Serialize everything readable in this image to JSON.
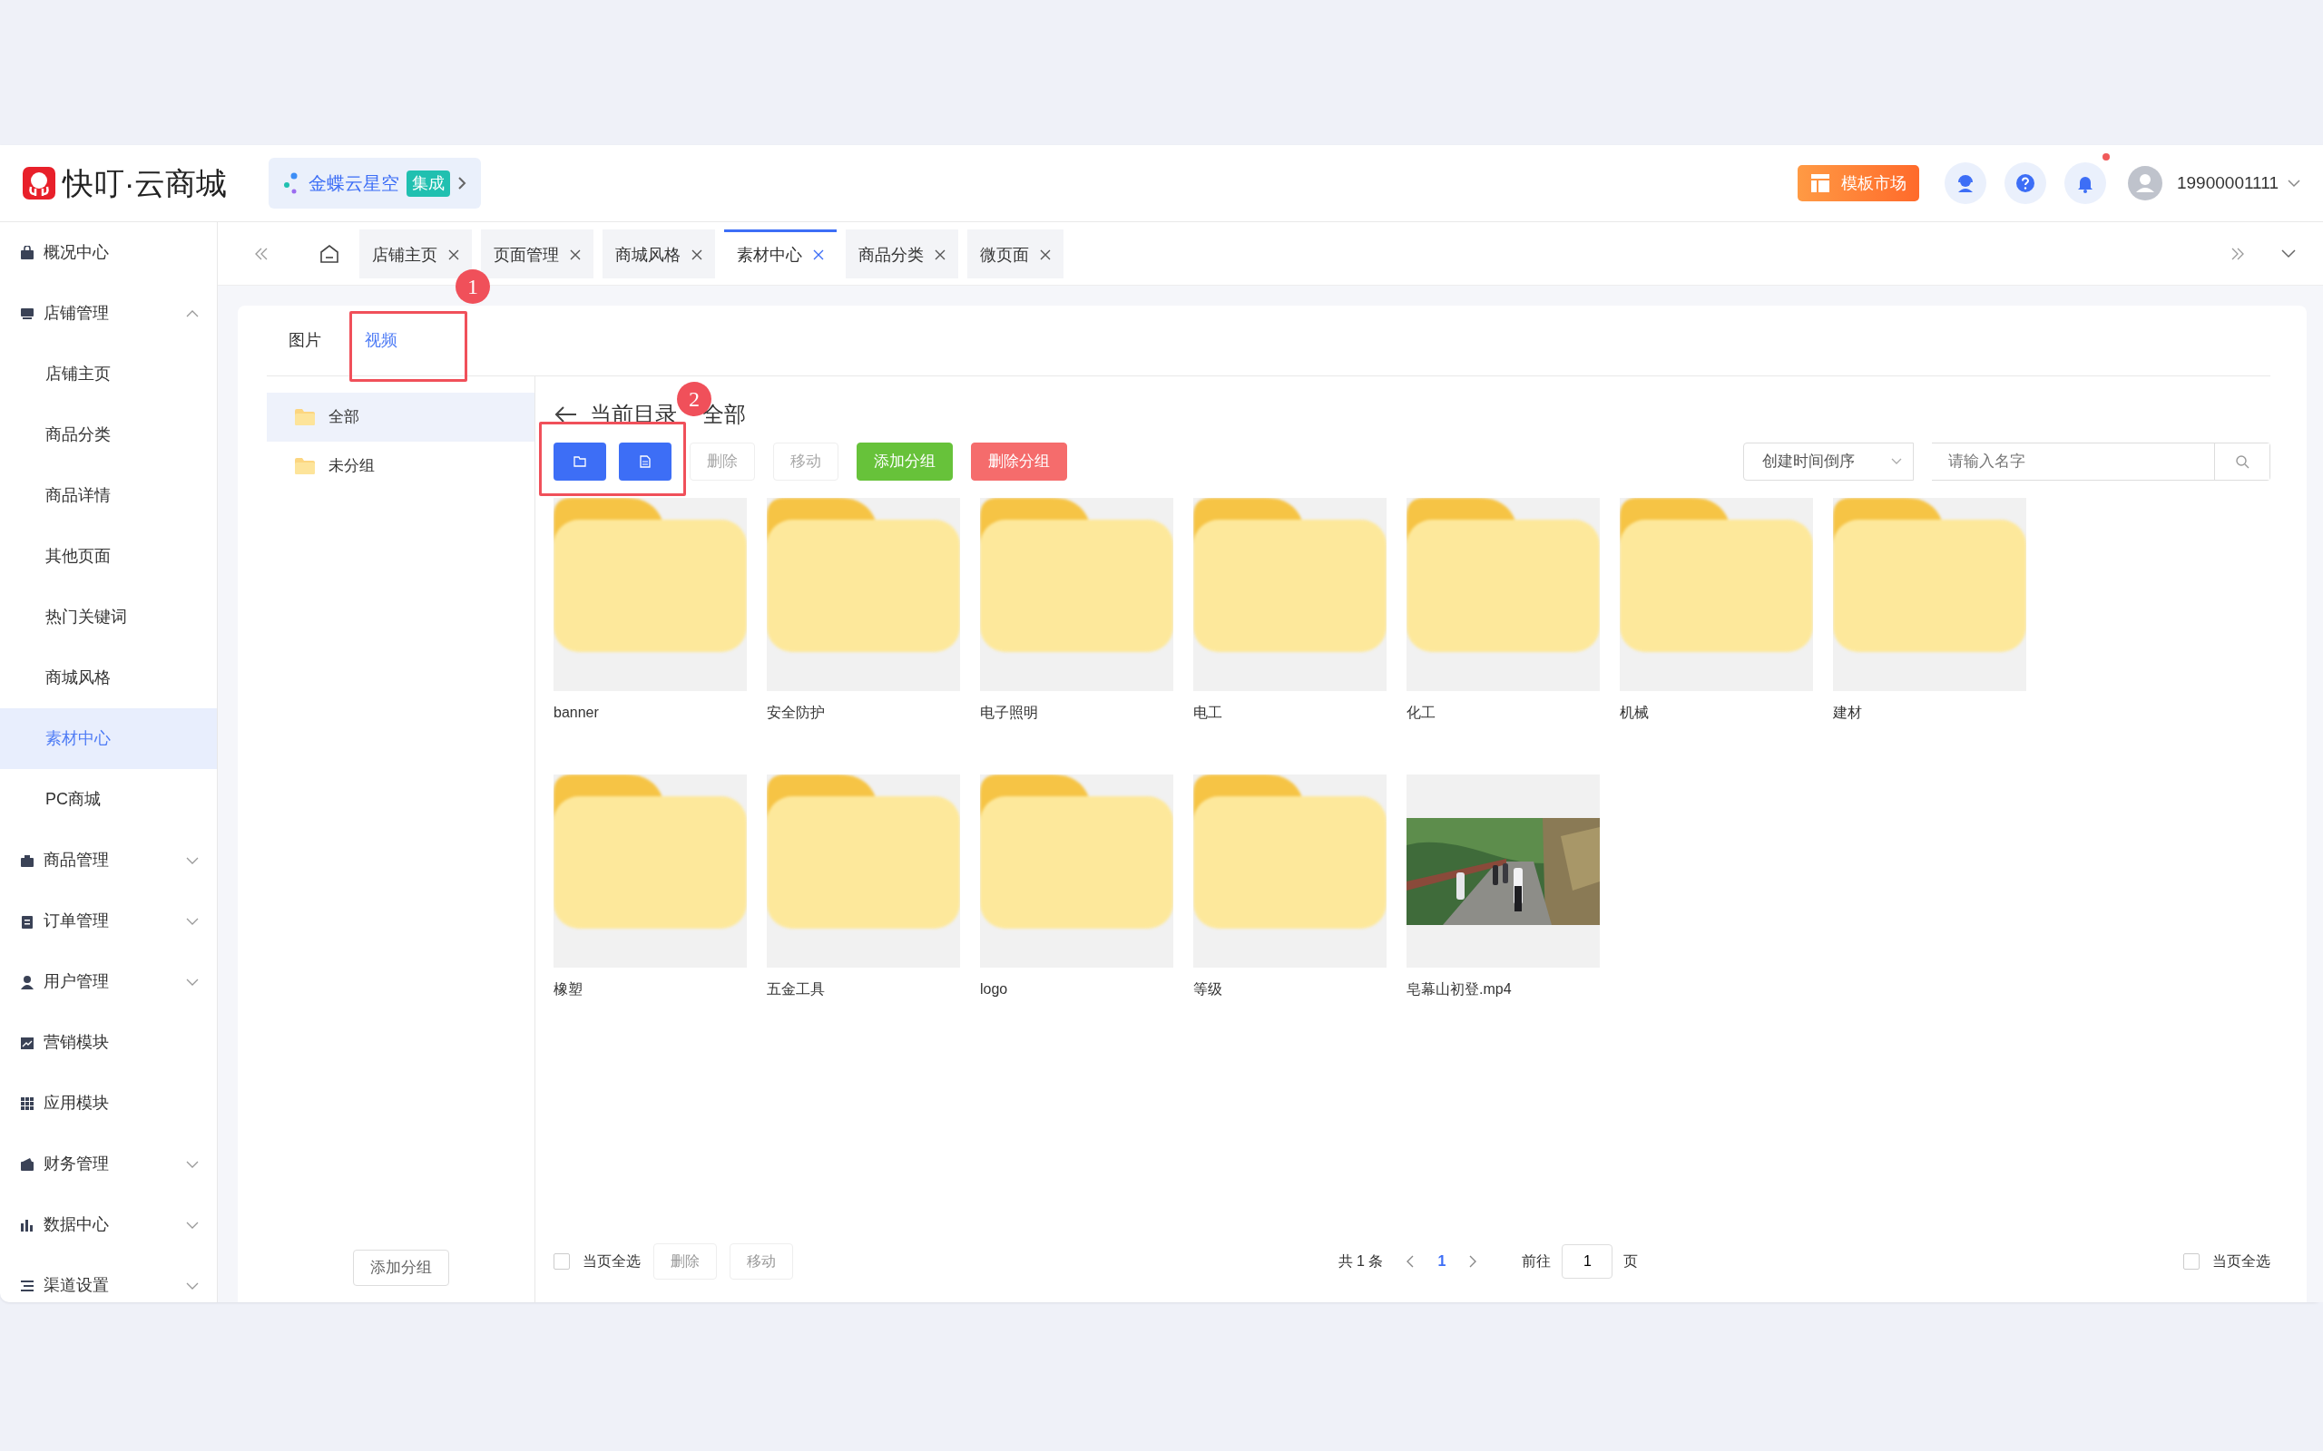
{
  "header": {
    "logo_text": "快叮·云商城",
    "integration": {
      "label": "金蝶云星空",
      "badge": "集成"
    },
    "market_button": "模板市场",
    "notification_dot": true,
    "user": "19900001111"
  },
  "sidebar": {
    "items": [
      {
        "kind": "link",
        "label": "概况中心",
        "selected": false
      },
      {
        "kind": "group",
        "label": "店铺管理",
        "expanded": true,
        "children": [
          {
            "label": "店铺主页",
            "selected": false
          },
          {
            "label": "商品分类",
            "selected": false
          },
          {
            "label": "商品详情",
            "selected": false
          },
          {
            "label": "其他页面",
            "selected": false
          },
          {
            "label": "热门关键词",
            "selected": false
          },
          {
            "label": "商城风格",
            "selected": false
          },
          {
            "label": "素材中心",
            "selected": true
          },
          {
            "label": "PC商城",
            "selected": false
          }
        ]
      },
      {
        "kind": "group",
        "label": "商品管理",
        "expanded": false
      },
      {
        "kind": "group",
        "label": "订单管理",
        "expanded": false
      },
      {
        "kind": "group",
        "label": "用户管理",
        "expanded": false
      },
      {
        "kind": "link",
        "label": "营销模块",
        "selected": false
      },
      {
        "kind": "link",
        "label": "应用模块",
        "selected": false
      },
      {
        "kind": "group",
        "label": "财务管理",
        "expanded": false
      },
      {
        "kind": "group",
        "label": "数据中心",
        "expanded": false
      },
      {
        "kind": "group",
        "label": "渠道设置",
        "expanded": false
      }
    ]
  },
  "page_tabs": [
    {
      "label": "店铺主页",
      "selected": false
    },
    {
      "label": "页面管理",
      "selected": false
    },
    {
      "label": "商城风格",
      "selected": false
    },
    {
      "label": "素材中心",
      "selected": true
    },
    {
      "label": "商品分类",
      "selected": false
    },
    {
      "label": "微页面",
      "selected": false
    }
  ],
  "media_tabs": [
    {
      "label": "图片",
      "selected": false
    },
    {
      "label": "视频",
      "selected": true
    }
  ],
  "annotations": [
    "1",
    "2"
  ],
  "groups": {
    "items": [
      {
        "label": "全部",
        "selected": true
      },
      {
        "label": "未分组",
        "selected": false
      }
    ],
    "add_button": "添加分组"
  },
  "toolbar": {
    "path_label": "当前目录",
    "path_value": "全部",
    "buttons": [
      {
        "kind": "plain",
        "label": "删除"
      },
      {
        "kind": "plain",
        "label": "移动"
      },
      {
        "kind": "success",
        "label": "添加分组"
      },
      {
        "kind": "danger",
        "label": "删除分组"
      }
    ],
    "sort": "创建时间倒序",
    "search": {
      "placeholder": "请输入名字"
    }
  },
  "files": [
    {
      "kind": "folder",
      "name": "banner"
    },
    {
      "kind": "folder",
      "name": "安全防护"
    },
    {
      "kind": "folder",
      "name": "电子照明"
    },
    {
      "kind": "folder",
      "name": "电工"
    },
    {
      "kind": "folder",
      "name": "化工"
    },
    {
      "kind": "folder",
      "name": "机械"
    },
    {
      "kind": "folder",
      "name": "建材"
    },
    {
      "kind": "folder",
      "name": "橡塑"
    },
    {
      "kind": "folder",
      "name": "五金工具"
    },
    {
      "kind": "folder",
      "name": "logo"
    },
    {
      "kind": "folder",
      "name": "等级"
    },
    {
      "kind": "video",
      "name": "皂幕山初登.mp4"
    }
  ],
  "footer": {
    "select_all": "当页全选",
    "checked": false,
    "buttons": [
      "删除",
      "移动"
    ],
    "total": "共 1 条",
    "current_page": "1",
    "goto_label": "前往",
    "goto_value": "1",
    "page_unit": "页",
    "right_select_all": "当页全选",
    "right_checked": false
  }
}
